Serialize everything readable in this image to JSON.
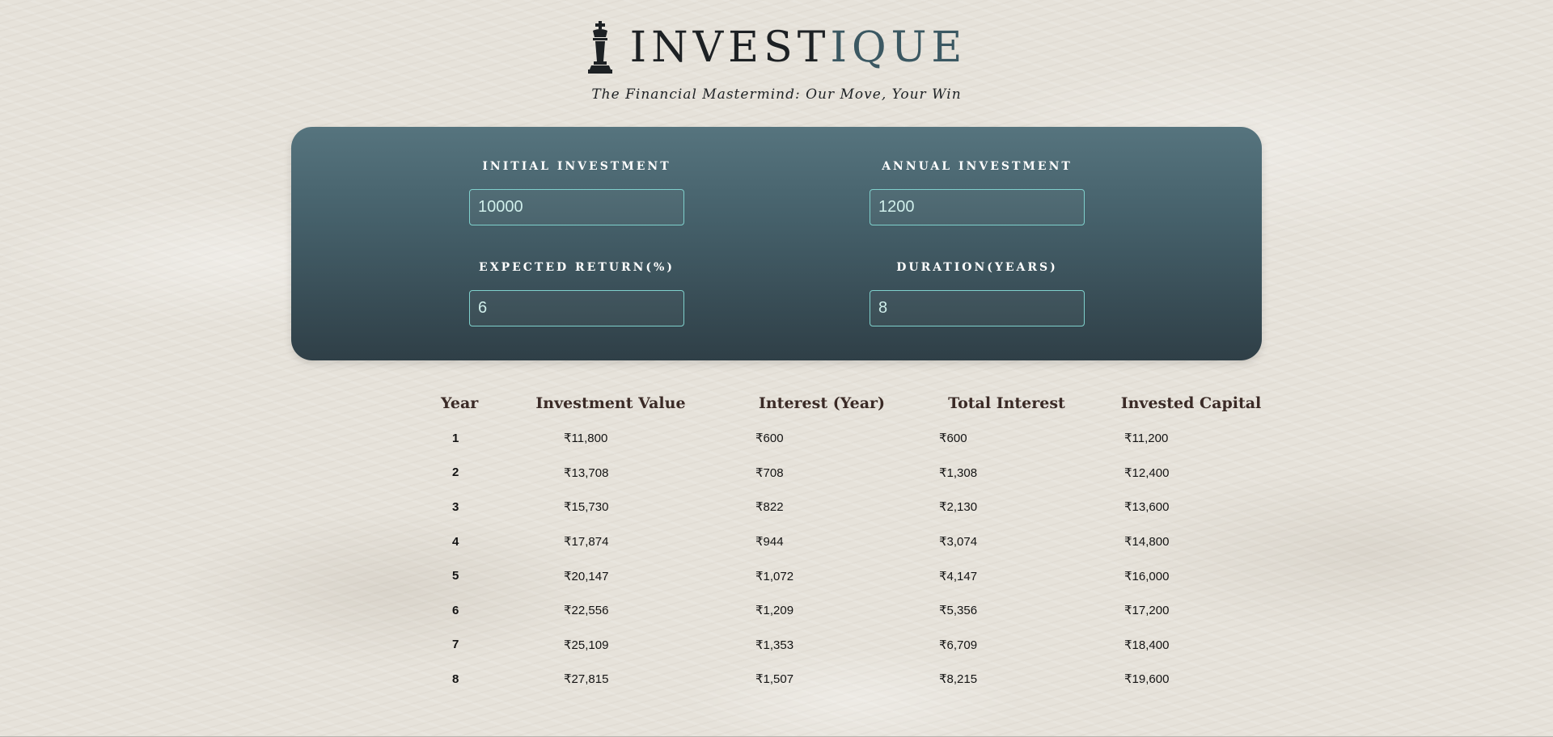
{
  "header": {
    "brand_main": "INVEST",
    "brand_accent": "IQUE",
    "tagline": "The Financial Mastermind: Our Move, Your Win",
    "logo_icon": "chess-king-icon"
  },
  "inputs": {
    "initial_investment": {
      "label": "INITIAL INVESTMENT",
      "value": "10000"
    },
    "annual_investment": {
      "label": "ANNUAL INVESTMENT",
      "value": "1200"
    },
    "expected_return": {
      "label": "EXPECTED RETURN(%)",
      "value": "6"
    },
    "duration": {
      "label": "DURATION(YEARS)",
      "value": "8"
    }
  },
  "table": {
    "headers": {
      "year": "Year",
      "investment_value": "Investment Value",
      "interest_year": "Interest (Year)",
      "total_interest": "Total Interest",
      "invested_capital": "Invested Capital"
    },
    "rows": [
      {
        "year": "1",
        "investment_value": "₹11,800",
        "interest_year": "₹600",
        "total_interest": "₹600",
        "invested_capital": "₹11,200"
      },
      {
        "year": "2",
        "investment_value": "₹13,708",
        "interest_year": "₹708",
        "total_interest": "₹1,308",
        "invested_capital": "₹12,400"
      },
      {
        "year": "3",
        "investment_value": "₹15,730",
        "interest_year": "₹822",
        "total_interest": "₹2,130",
        "invested_capital": "₹13,600"
      },
      {
        "year": "4",
        "investment_value": "₹17,874",
        "interest_year": "₹944",
        "total_interest": "₹3,074",
        "invested_capital": "₹14,800"
      },
      {
        "year": "5",
        "investment_value": "₹20,147",
        "interest_year": "₹1,072",
        "total_interest": "₹4,147",
        "invested_capital": "₹16,000"
      },
      {
        "year": "6",
        "investment_value": "₹22,556",
        "interest_year": "₹1,209",
        "total_interest": "₹5,356",
        "invested_capital": "₹17,200"
      },
      {
        "year": "7",
        "investment_value": "₹25,109",
        "interest_year": "₹1,353",
        "total_interest": "₹6,709",
        "invested_capital": "₹18,400"
      },
      {
        "year": "8",
        "investment_value": "₹27,815",
        "interest_year": "₹1,507",
        "total_interest": "₹8,215",
        "invested_capital": "₹19,600"
      }
    ]
  },
  "colors": {
    "brand_accent": "#3b5862",
    "panel_top": "#56747e",
    "panel_bottom": "#2f3f47",
    "input_border": "#7fd0cc",
    "table_header": "#3a2a26"
  }
}
